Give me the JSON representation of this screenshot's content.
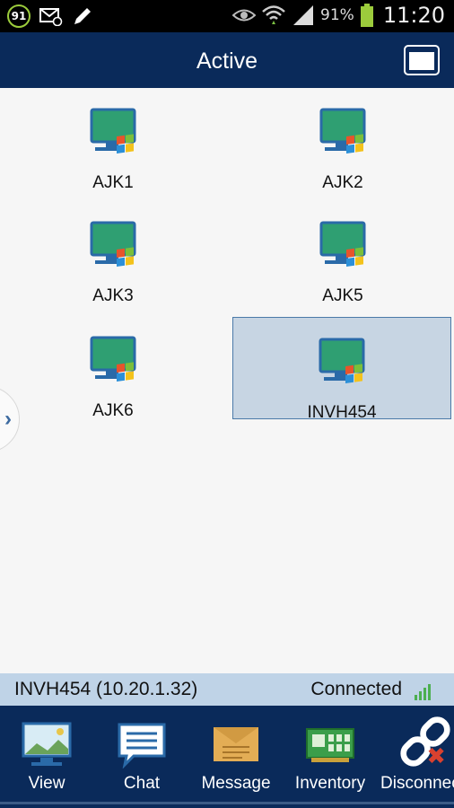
{
  "status_bar": {
    "badge": "91",
    "battery_percent": "91%",
    "time": "11:20",
    "icons": [
      "badge-icon",
      "mail-icon",
      "pen-icon",
      "eye-icon",
      "wifi-icon",
      "signal-icon",
      "battery-icon"
    ]
  },
  "header": {
    "title": "Active",
    "right_button_icon": "window-icon"
  },
  "devices": [
    {
      "label": "AJK1",
      "selected": false
    },
    {
      "label": "AJK2",
      "selected": false
    },
    {
      "label": "AJK3",
      "selected": false
    },
    {
      "label": "AJK5",
      "selected": false
    },
    {
      "label": "AJK6",
      "selected": false
    },
    {
      "label": "INVH454",
      "selected": true
    }
  ],
  "side_handle": {
    "glyph": "›"
  },
  "connection": {
    "host": "INVH454 (10.20.1.32)",
    "status": "Connected"
  },
  "toolbar": {
    "items": [
      {
        "label": "View",
        "icon": "monitor-icon"
      },
      {
        "label": "Chat",
        "icon": "chat-icon"
      },
      {
        "label": "Message",
        "icon": "message-icon"
      },
      {
        "label": "Inventory",
        "icon": "inventory-icon"
      },
      {
        "label": "Disconnect",
        "icon": "disconnect-icon"
      }
    ]
  },
  "colors": {
    "header": "#0a2a5a",
    "selected_tile": "#c7d5e3",
    "connection_bar": "#bfd3e7",
    "signal": "#4caf50"
  }
}
